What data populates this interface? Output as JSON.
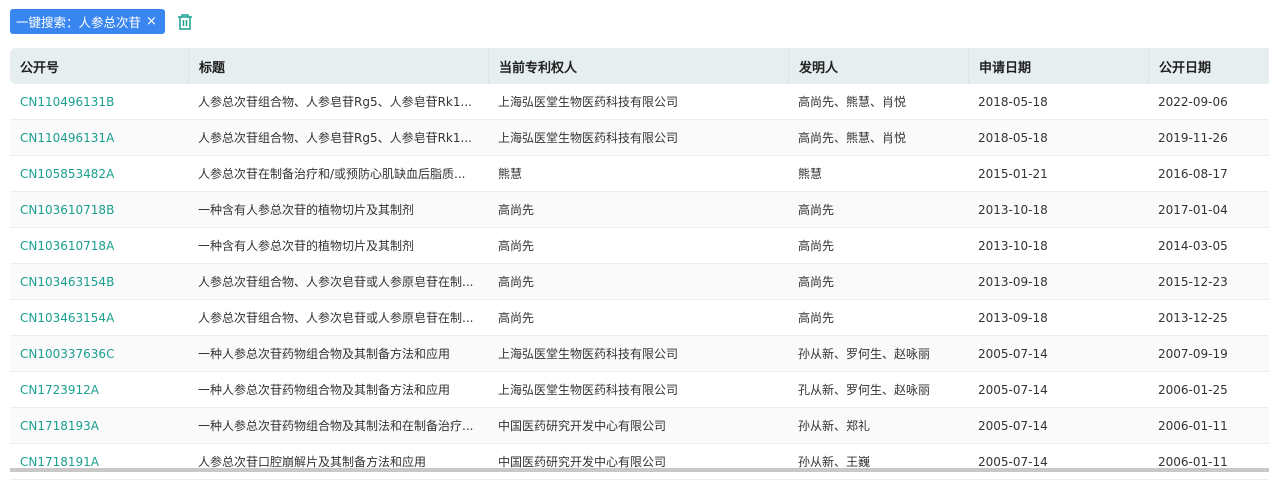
{
  "filter_tag": {
    "label": "一键搜索：人参总次苷",
    "close": "×"
  },
  "columns": [
    "公开号",
    "标题",
    "当前专利权人",
    "发明人",
    "申请日期",
    "公开日期"
  ],
  "rows": [
    [
      "CN110496131B",
      "人参总次苷组合物、人参皂苷Rg5、人参皂苷Rk1...",
      "上海弘医堂生物医药科技有限公司",
      "高尚先、熊慧、肖悦",
      "2018-05-18",
      "2022-09-06"
    ],
    [
      "CN110496131A",
      "人参总次苷组合物、人参皂苷Rg5、人参皂苷Rk1...",
      "上海弘医堂生物医药科技有限公司",
      "高尚先、熊慧、肖悦",
      "2018-05-18",
      "2019-11-26"
    ],
    [
      "CN105853482A",
      "人参总次苷在制备治疗和/或预防心肌缺血后脂质...",
      "熊慧",
      "熊慧",
      "2015-01-21",
      "2016-08-17"
    ],
    [
      "CN103610718B",
      "一种含有人参总次苷的植物切片及其制剂",
      "高尚先",
      "高尚先",
      "2013-10-18",
      "2017-01-04"
    ],
    [
      "CN103610718A",
      "一种含有人参总次苷的植物切片及其制剂",
      "高尚先",
      "高尚先",
      "2013-10-18",
      "2014-03-05"
    ],
    [
      "CN103463154B",
      "人参总次苷组合物、人参次皂苷或人参原皂苷在制...",
      "高尚先",
      "高尚先",
      "2013-09-18",
      "2015-12-23"
    ],
    [
      "CN103463154A",
      "人参总次苷组合物、人参次皂苷或人参原皂苷在制...",
      "高尚先",
      "高尚先",
      "2013-09-18",
      "2013-12-25"
    ],
    [
      "CN100337636C",
      "一种人参总次苷药物组合物及其制备方法和应用",
      "上海弘医堂生物医药科技有限公司",
      "孙从新、罗何生、赵咏丽",
      "2005-07-14",
      "2007-09-19"
    ],
    [
      "CN1723912A",
      "一种人参总次苷药物组合物及其制备方法和应用",
      "上海弘医堂生物医药科技有限公司",
      "孔从新、罗何生、赵咏丽",
      "2005-07-14",
      "2006-01-25"
    ],
    [
      "CN1718193A",
      "一种人参总次苷药物组合物及其制法和在制备治疗...",
      "中国医药研究开发中心有限公司",
      "孙从新、郑礼",
      "2005-07-14",
      "2006-01-11"
    ],
    [
      "CN1718191A",
      "人参总次苷口腔崩解片及其制备方法和应用",
      "中国医药研究开发中心有限公司",
      "孙从新、王巍",
      "2005-07-14",
      "2006-01-11"
    ]
  ]
}
